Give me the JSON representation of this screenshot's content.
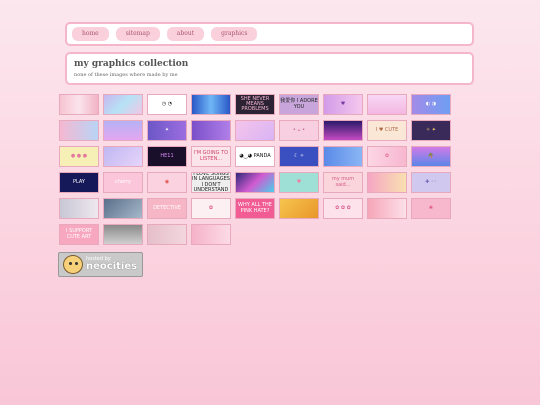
{
  "nav": {
    "items": [
      {
        "label": "home"
      },
      {
        "label": "sitemap"
      },
      {
        "label": "about"
      },
      {
        "label": "graphics"
      }
    ]
  },
  "header": {
    "title": "my graphics collection",
    "subtitle": "none of these images where made by me"
  },
  "graphics": {
    "rows": [
      [
        {
          "text": "",
          "bg": "linear-gradient(90deg,#f6c4d2,#fbe4ec,#f2b3c5)",
          "fg": "#fff"
        },
        {
          "text": "",
          "bg": "linear-gradient(135deg,#c9b7f0,#b6e2f5,#f0c6e6)",
          "fg": "#fff"
        },
        {
          "text": "◷ ◔",
          "bg": "#ffffff",
          "fg": "#222"
        },
        {
          "text": "",
          "bg": "linear-gradient(90deg,#2a57c8,#6fb7f5,#2a57c8)",
          "fg": "#fff"
        },
        {
          "text": "SHE NEVER MEANS PROBLEMS",
          "bg": "#2b2233",
          "fg": "#f7b8d3"
        },
        {
          "text": "我爱你 I ADORE YOU",
          "bg": "#c8a6dc",
          "fg": "#222"
        },
        {
          "text": "♥",
          "bg": "linear-gradient(90deg,#d39be8,#f4c8ee)",
          "fg": "#7b3ea0"
        },
        {
          "text": "",
          "bg": "linear-gradient(180deg,#f8d7f5,#f4b7e2)",
          "fg": "#fff"
        },
        {
          "text": "◐ ◑",
          "bg": "linear-gradient(90deg,#a38be8,#6e9ef2)",
          "fg": "#fff"
        }
      ],
      [
        {
          "text": "",
          "bg": "linear-gradient(90deg,#f5b8d2,#b8d4f5)",
          "fg": "#fff"
        },
        {
          "text": "",
          "bg": "linear-gradient(180deg,#b6b2f5,#e4a6f0)",
          "fg": "#fff"
        },
        {
          "text": "✦",
          "bg": "linear-gradient(90deg,#6c57c6,#9b6de0)",
          "fg": "#fff"
        },
        {
          "text": "",
          "bg": "linear-gradient(90deg,#7a4fc9,#b07fe8)",
          "fg": "#fff"
        },
        {
          "text": "",
          "bg": "linear-gradient(135deg,#f5c4ea,#d8b4f5)",
          "fg": "#fff"
        },
        {
          "text": "• ᴗ •",
          "bg": "#f8cfe0",
          "fg": "#c0587d"
        },
        {
          "text": "",
          "bg": "linear-gradient(180deg,#2b1a6a,#c54ac2)",
          "fg": "#fff"
        },
        {
          "text": "I ♥ CUTE",
          "bg": "#fbe7d6",
          "fg": "#b06a4a"
        },
        {
          "text": "✧ ✦",
          "bg": "#3a2a5a",
          "fg": "#f5d26a"
        }
      ],
      [
        {
          "text": "● ● ●",
          "bg": "#f7f0b6",
          "fg": "#e57a9e"
        },
        {
          "text": "",
          "bg": "linear-gradient(135deg,#c0b8f2,#e6d4fa)",
          "fg": "#fff"
        },
        {
          "text": "HE11",
          "bg": "#1a0f2a",
          "fg": "#d58af5"
        },
        {
          "text": "I'M GOING TO LISTEN...",
          "bg": "#fbe4ea",
          "fg": "#d2456a"
        },
        {
          "text": "◕‿◕ PANDA",
          "bg": "#ffffff",
          "fg": "#111"
        },
        {
          "text": "☾ ✧",
          "bg": "#3a4fc0",
          "fg": "#fff"
        },
        {
          "text": "",
          "bg": "linear-gradient(90deg,#5a8ae8,#8ab6f5)",
          "fg": "#fff"
        },
        {
          "text": "✿",
          "bg": "linear-gradient(90deg,#fcd6e4,#f7b7cf)",
          "fg": "#e2688e"
        },
        {
          "text": "🌴",
          "bg": "linear-gradient(180deg,#d27ae8,#5a86e8)",
          "fg": "#fff"
        }
      ],
      [
        {
          "text": "PLAY",
          "bg": "#15195a",
          "fg": "#ffffff"
        },
        {
          "text": "cherry",
          "bg": "#fbc6d9",
          "fg": "#fff"
        },
        {
          "text": "◉",
          "bg": "#fbd3e0",
          "fg": "#e24c4c"
        },
        {
          "text": "I LOVE SONGS IN LANGUAGES I DON'T UNDERSTAND",
          "bg": "#eeeeee",
          "fg": "#222"
        },
        {
          "text": "",
          "bg": "linear-gradient(135deg,#2e2a7a,#d15ad0,#4ad0e8)",
          "fg": "#fff"
        },
        {
          "text": "♥",
          "bg": "#9fe0d6",
          "fg": "#f27aa0"
        },
        {
          "text": "my mum said...",
          "bg": "#fbd5dc",
          "fg": "#d75a86"
        },
        {
          "text": "",
          "bg": "linear-gradient(90deg,#f6a6c4,#f8e0b0)",
          "fg": "#fff"
        },
        {
          "text": "✚ ◦◦",
          "bg": "#d0c8ee",
          "fg": "#6a5ab0"
        }
      ],
      [
        {
          "text": "",
          "bg": "linear-gradient(90deg,#c7c7d4,#efe7ef)",
          "fg": "#fff"
        },
        {
          "text": "",
          "bg": "linear-gradient(135deg,#5a6f8a,#a6b8c9)",
          "fg": "#fff"
        },
        {
          "text": "DETECTIVE",
          "bg": "#f7b6c6",
          "fg": "#fff"
        },
        {
          "text": "✿",
          "bg": "#fdf0f3",
          "fg": "#e2487a"
        },
        {
          "text": "WHY ALL THE PINK HATE?",
          "bg": "#f25c95",
          "fg": "#fff"
        },
        {
          "text": "",
          "bg": "linear-gradient(135deg,#f6c54e,#e8962a)",
          "fg": "#fff"
        },
        {
          "text": "✿ ✿ ✿",
          "bg": "#fde2eb",
          "fg": "#d94e85"
        },
        {
          "text": "",
          "bg": "linear-gradient(90deg,#f5a6b8,#fde0e8)",
          "fg": "#fff"
        },
        {
          "text": "❀",
          "bg": "#f7b7cc",
          "fg": "#e14f7f"
        }
      ],
      [
        {
          "text": "I SUPPORT CUTE ART",
          "bg": "#f7a8c0",
          "fg": "#fff"
        },
        {
          "text": "",
          "bg": "linear-gradient(180deg,#8a8a8a,#d0d0d0)",
          "fg": "#fff"
        },
        {
          "text": "",
          "bg": "linear-gradient(90deg,#e6bfcb,#f2d6de)",
          "fg": "#fff"
        },
        {
          "text": "",
          "bg": "linear-gradient(90deg,#f5b2c9,#fcdbe6)",
          "fg": "#fff"
        }
      ]
    ]
  },
  "badge": {
    "small": "hosted by",
    "big": "neocities"
  }
}
